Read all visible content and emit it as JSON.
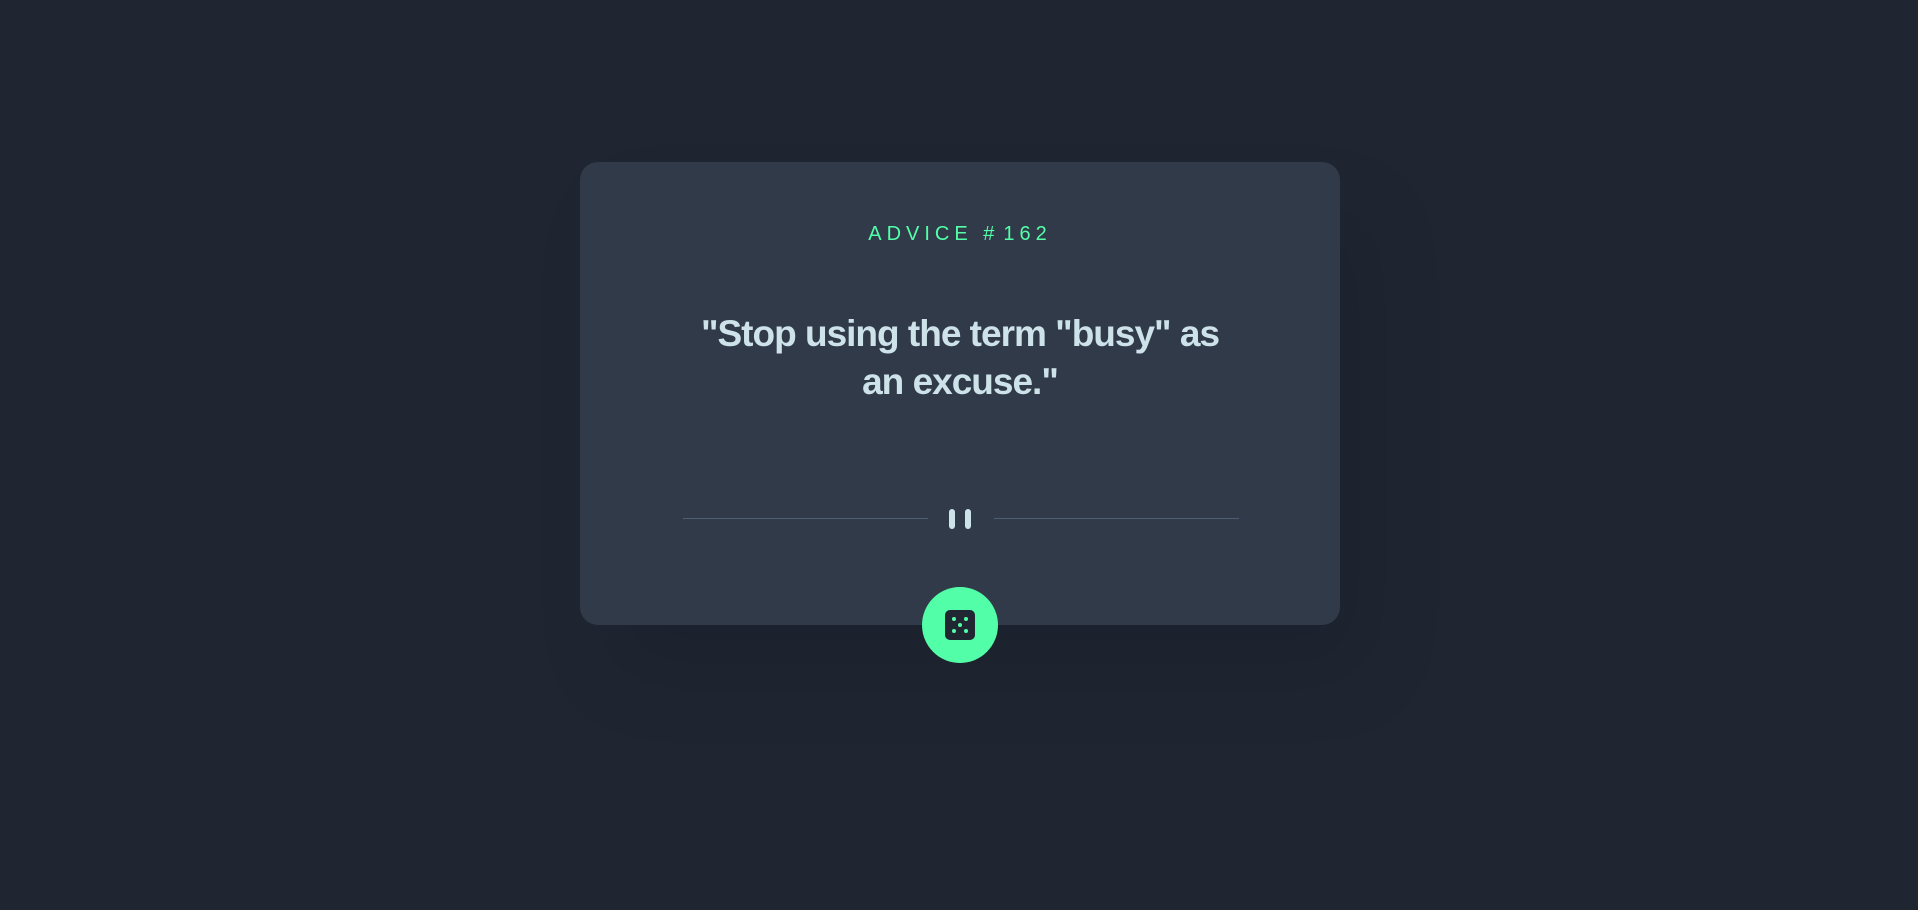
{
  "advice": {
    "label": "ADVICE #",
    "number": "162",
    "quote": "\"Stop using the term \"busy\" as an excuse.\""
  },
  "controls": {
    "generate_icon": "dice-icon",
    "divider_icon": "pause-icon"
  },
  "colors": {
    "background": "#1f2632",
    "card": "#313a49",
    "accent": "#52ffa8",
    "text": "#cee3e9"
  }
}
